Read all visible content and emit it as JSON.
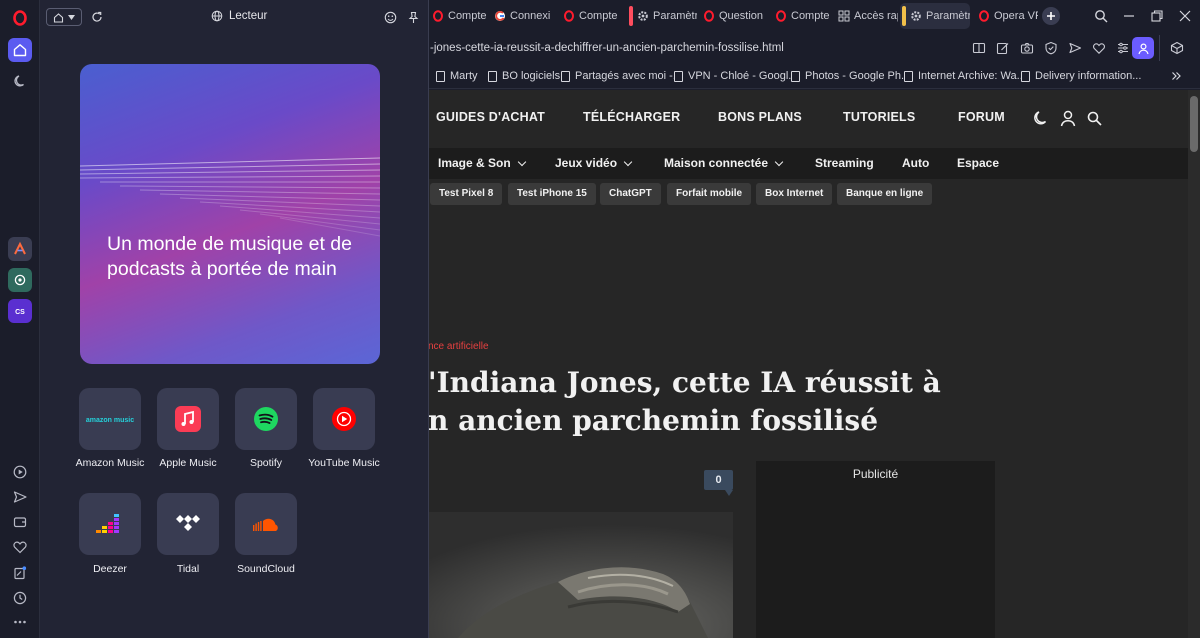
{
  "player": {
    "title": "Lecteur",
    "hero_title": "Un monde de musique et de podcasts à portée de main",
    "services": [
      {
        "label": "Amazon Music",
        "logo_text": "amazon music"
      },
      {
        "label": "Apple Music"
      },
      {
        "label": "Spotify"
      },
      {
        "label": "YouTube Music"
      },
      {
        "label": "Deezer"
      },
      {
        "label": "Tidal"
      },
      {
        "label": "SoundCloud"
      }
    ]
  },
  "tabs": [
    {
      "label": "Compte",
      "icon": "opera-icon"
    },
    {
      "label": "Connexio",
      "icon": "google-icon"
    },
    {
      "label": "Compte",
      "icon": "opera-icon"
    },
    {
      "label": "Paramètr",
      "icon": "gear-icon"
    },
    {
      "label": "Question",
      "icon": "opera-icon"
    },
    {
      "label": "Compte",
      "icon": "opera-icon"
    },
    {
      "label": "Accès rap",
      "icon": "grid-icon"
    },
    {
      "label": "Paramètr",
      "icon": "gear-icon"
    },
    {
      "label": "Opera VP",
      "icon": "opera-icon"
    }
  ],
  "address": {
    "url": "-jones-cette-ia-reussit-a-dechiffrer-un-ancien-parchemin-fossilise.html"
  },
  "bookmarks": [
    {
      "label": "Marty"
    },
    {
      "label": "BO logiciels"
    },
    {
      "label": "Partagés avec moi -..."
    },
    {
      "label": "VPN - Chloé - Googl..."
    },
    {
      "label": "Photos - Google Ph..."
    },
    {
      "label": "Internet Archive: Wa..."
    },
    {
      "label": "Delivery information..."
    }
  ],
  "site": {
    "nav_main": [
      "GUIDES D'ACHAT",
      "TÉLÉCHARGER",
      "BONS PLANS",
      "TUTORIELS",
      "FORUM"
    ],
    "nav_sub": [
      {
        "label": "Image & Son",
        "dropdown": true
      },
      {
        "label": "Jeux vidéo",
        "dropdown": true
      },
      {
        "label": "Maison connectée",
        "dropdown": true
      },
      {
        "label": "Streaming",
        "dropdown": false
      },
      {
        "label": "Auto",
        "dropdown": false
      },
      {
        "label": "Espace",
        "dropdown": false
      }
    ],
    "tags": [
      "Test Pixel 8",
      "Test iPhone 15",
      "ChatGPT",
      "Forfait mobile",
      "Box Internet",
      "Banque en ligne"
    ],
    "category": "nce artificielle",
    "headline_line1": "'Indiana Jones, cette IA réussit à",
    "headline_line2": "n ancien parchemin fossilisé",
    "comments_count": "0",
    "ad_label": "Publicité"
  },
  "colors": {
    "opera_red": "#ff1b2d",
    "sidebar_active": "#5b5bf0",
    "vpn_purple": "#6b5cff",
    "category_red": "#e64040"
  }
}
